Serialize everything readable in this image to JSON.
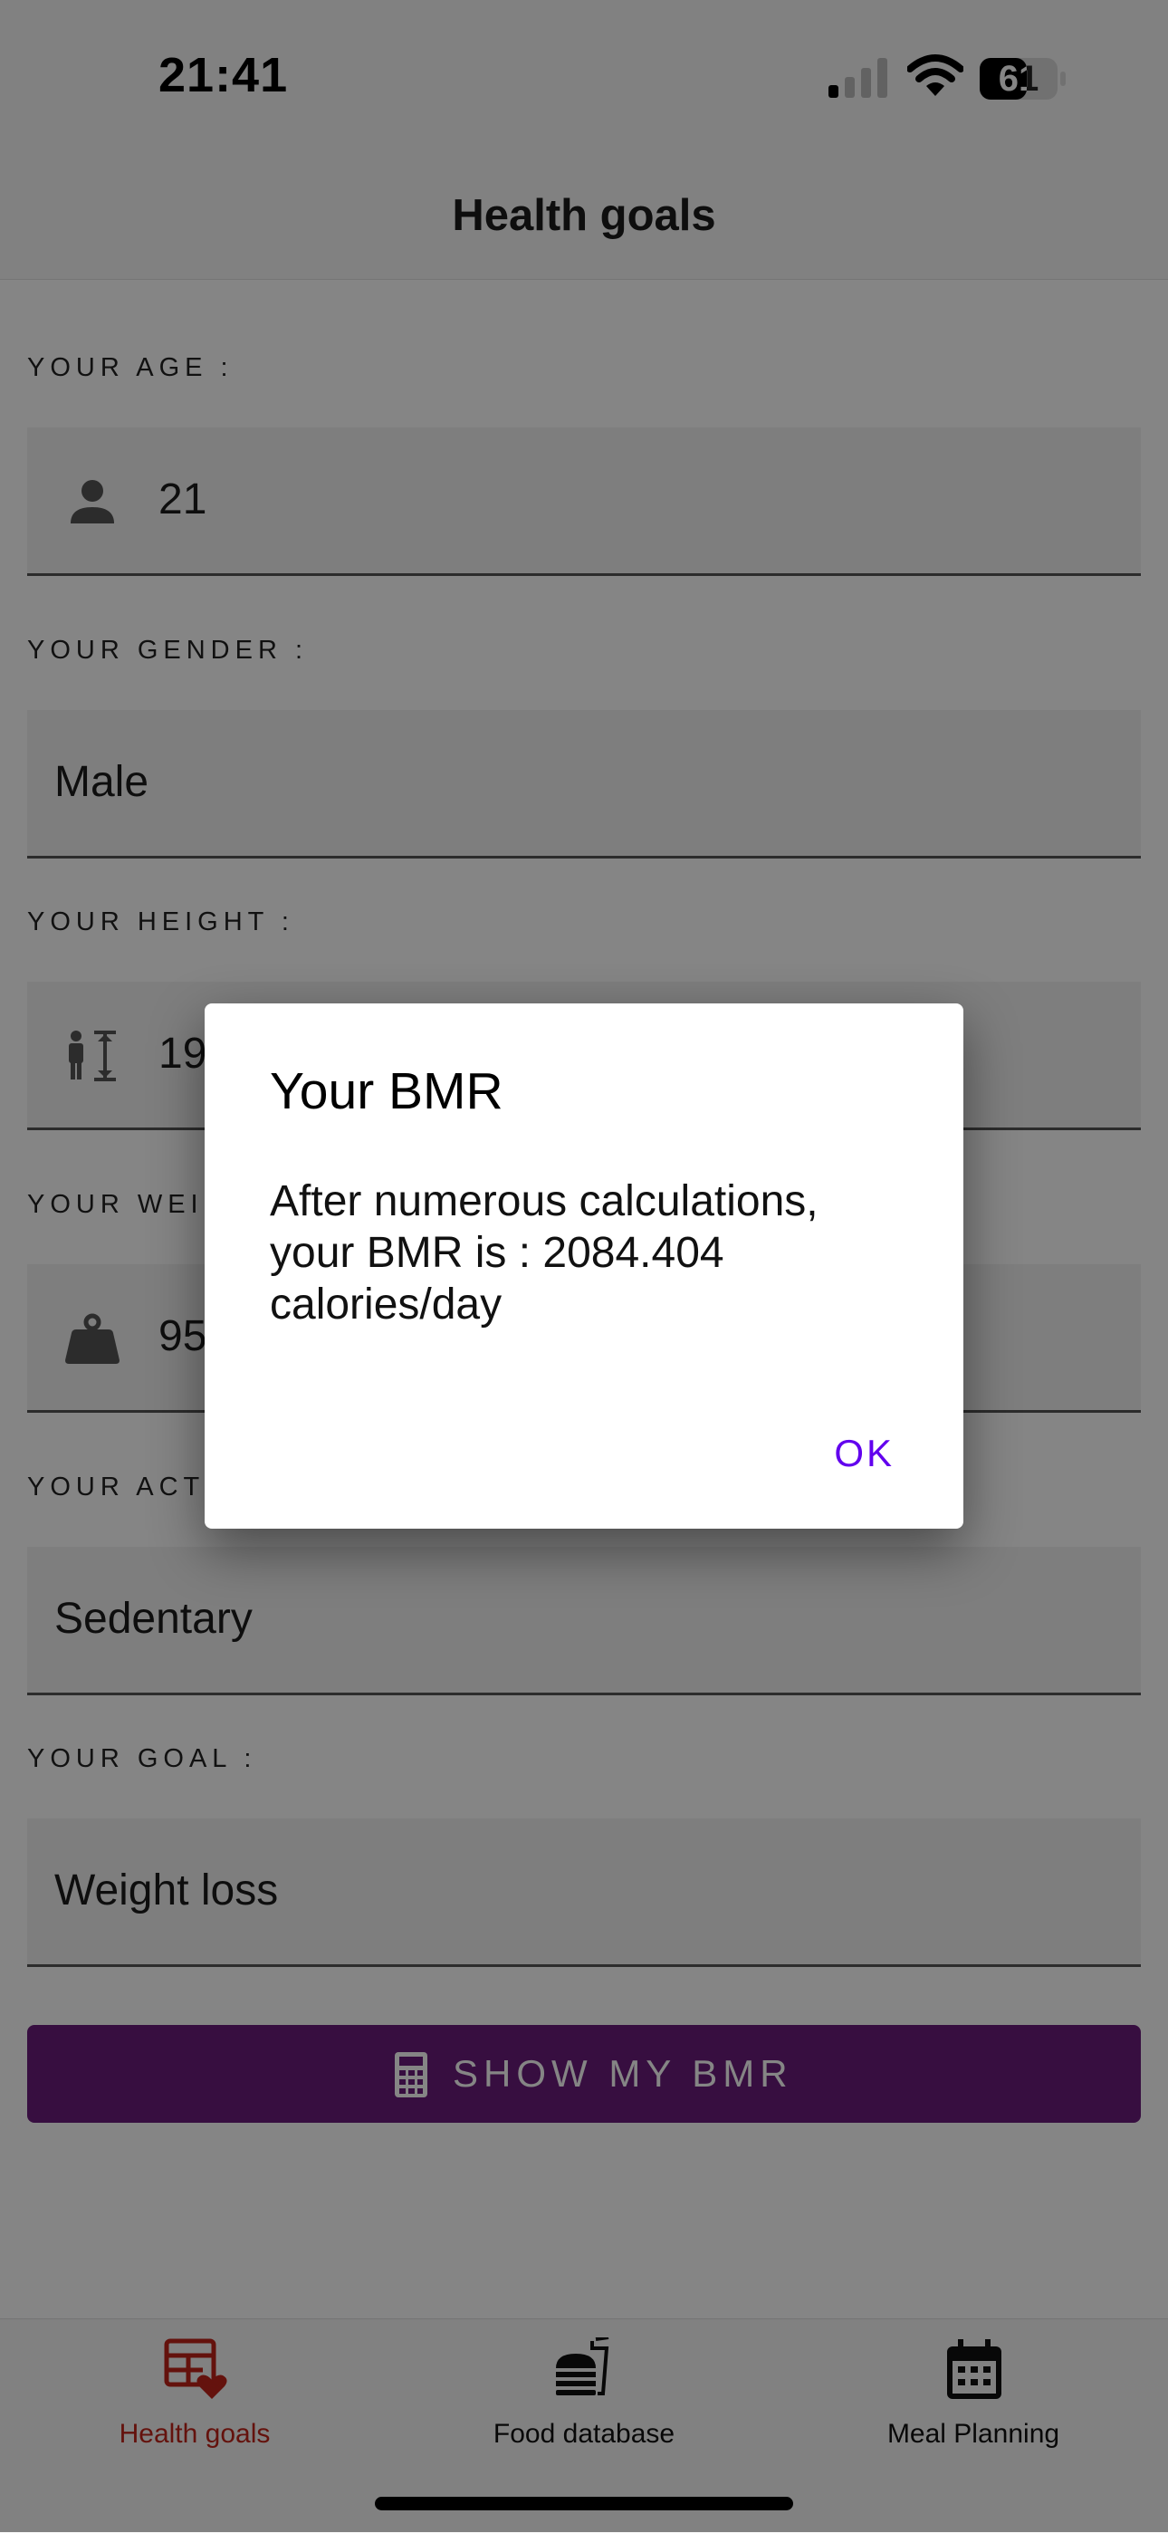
{
  "status_bar": {
    "time": "21:41",
    "battery": "61"
  },
  "header": {
    "title": "Health goals"
  },
  "form": {
    "age": {
      "label": "YOUR AGE :",
      "value": "21"
    },
    "gender": {
      "label": "YOUR GENDER :",
      "value": "Male"
    },
    "height": {
      "label": "YOUR HEIGHT :",
      "value": "19"
    },
    "weight": {
      "label": "YOUR WEI",
      "value": "95"
    },
    "activity": {
      "label": "YOUR ACTI",
      "value": "Sedentary"
    },
    "goal": {
      "label": "YOUR GOAL :",
      "value": "Weight loss"
    },
    "submit_label": "SHOW MY BMR"
  },
  "dialog": {
    "title": "Your BMR",
    "message": "After numerous calculations, your BMR is : 2084.404 calories/day",
    "ok_label": "OK"
  },
  "bottom_nav": {
    "items": [
      {
        "label": "Health goals",
        "icon": "health-goals-icon",
        "active": true
      },
      {
        "label": "Food database",
        "icon": "fast-food-icon",
        "active": false
      },
      {
        "label": "Meal Planning",
        "icon": "calendar-icon",
        "active": false
      }
    ]
  },
  "colors": {
    "accent": "#6a1b7c",
    "active_tab": "#c0241a",
    "dialog_button": "#6200ee"
  }
}
